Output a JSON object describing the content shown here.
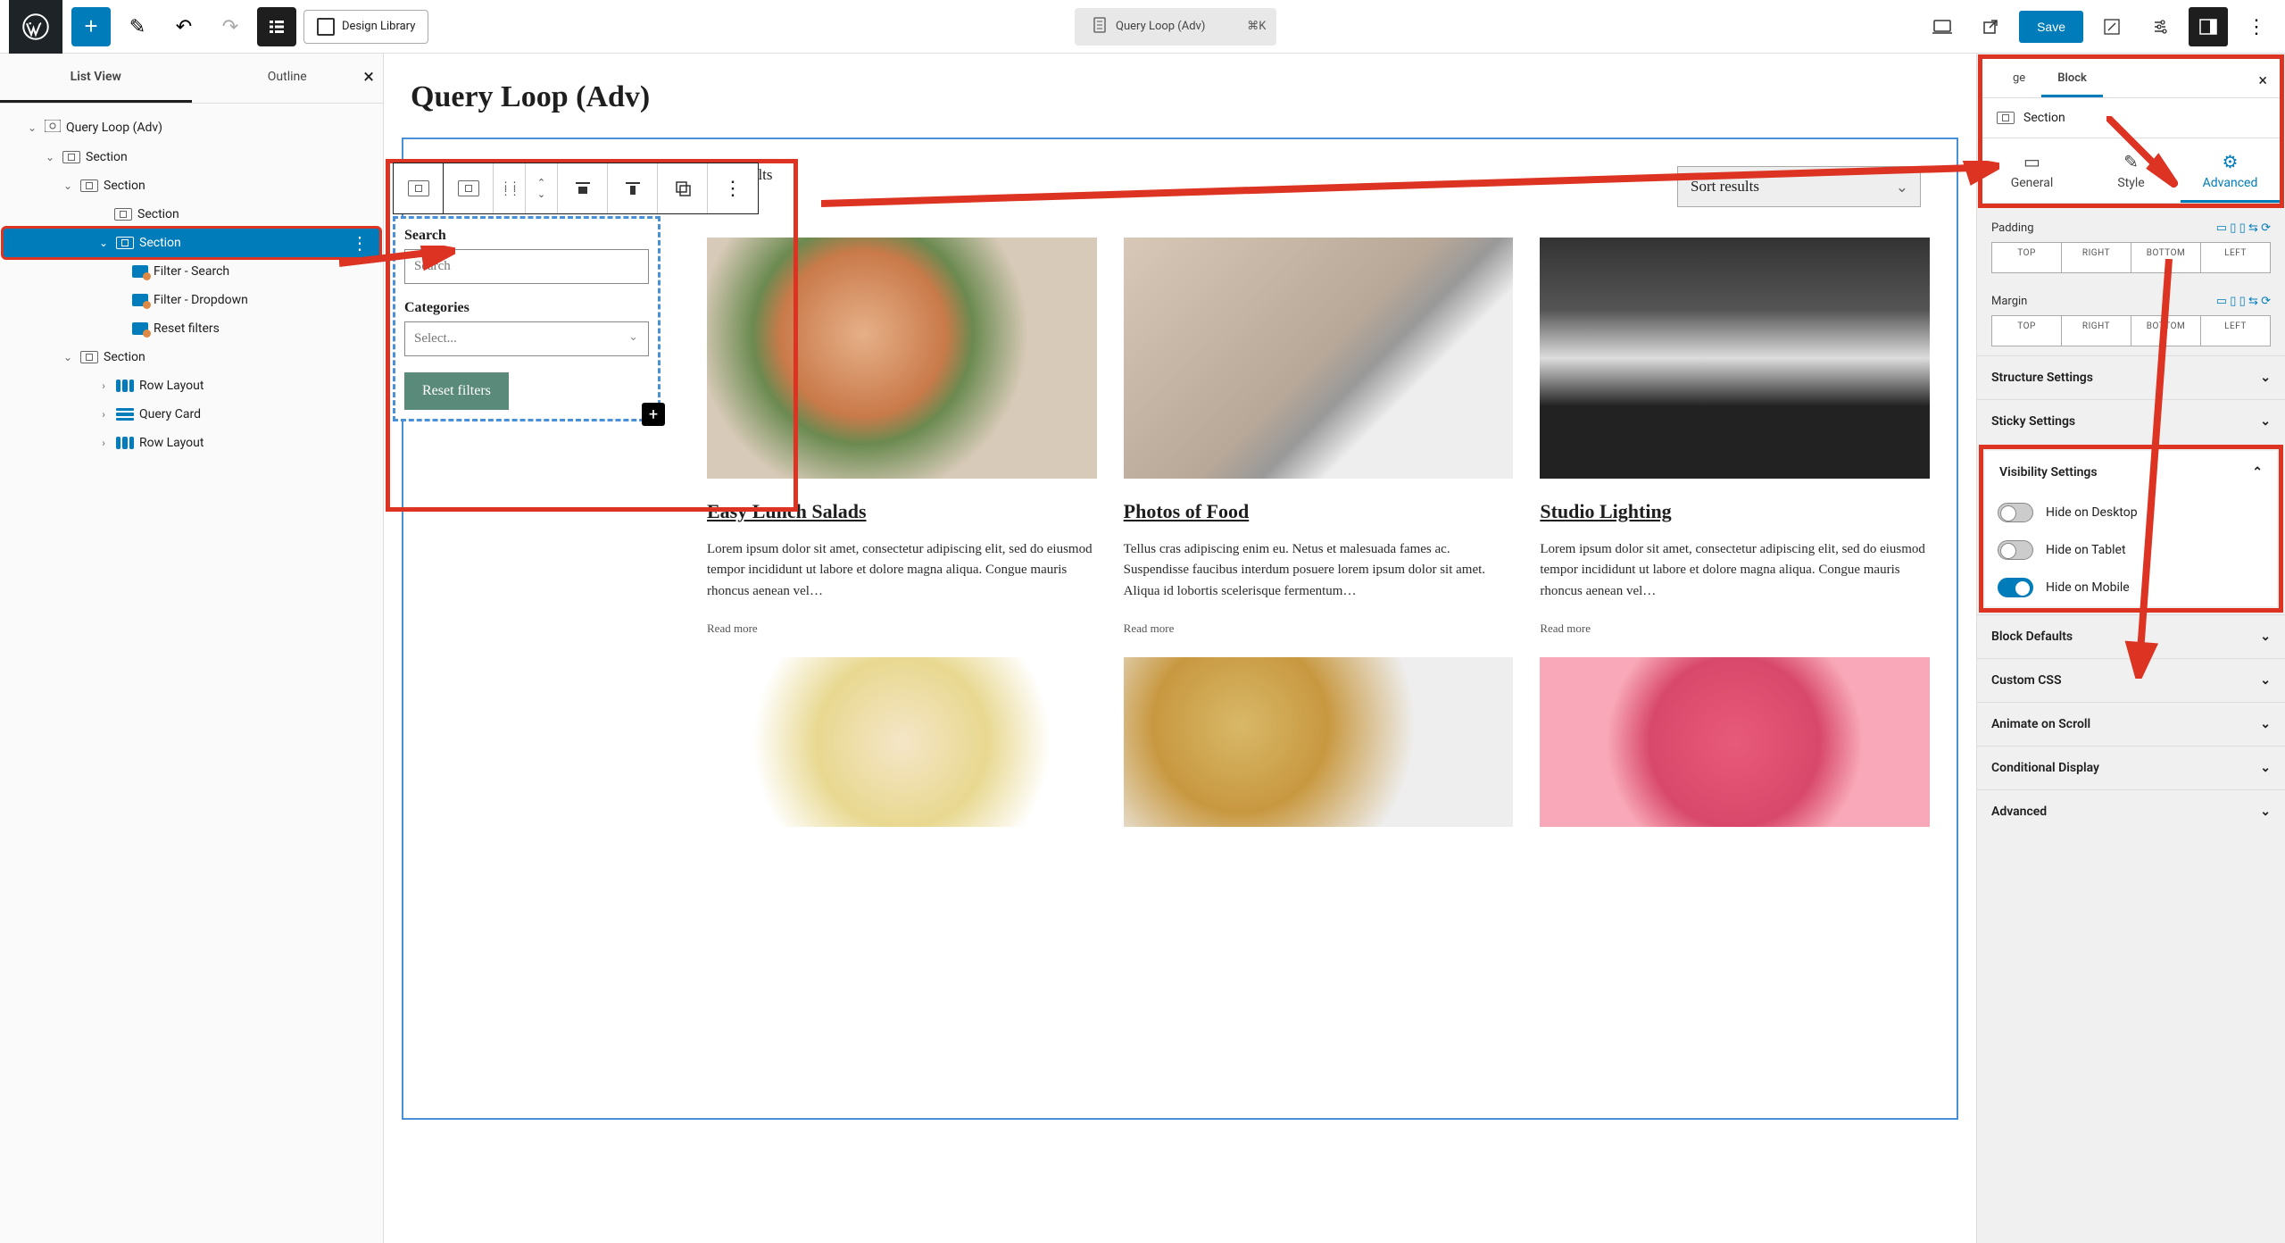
{
  "topbar": {
    "design_library": "Design Library",
    "page_title": "Query Loop (Adv)",
    "shortcut": "⌘K",
    "save": "Save"
  },
  "sidebar": {
    "tab_listview": "List View",
    "tab_outline": "Outline",
    "tree": {
      "root": "Query Loop (Adv)",
      "section": "Section",
      "filter_search": "Filter - Search",
      "filter_dropdown": "Filter - Dropdown",
      "reset_filters": "Reset filters",
      "row_layout": "Row Layout",
      "query_card": "Query Card"
    }
  },
  "canvas": {
    "title": "Query Loop (Adv)",
    "results_count": "10 results",
    "sort_label": "Sort results",
    "filter_panel": {
      "search_label": "Search",
      "search_placeholder": "Search",
      "categories_label": "Categories",
      "categories_placeholder": "Select...",
      "reset": "Reset filters"
    },
    "cards": [
      {
        "title": "Easy Lunch Salads",
        "body": "Lorem ipsum dolor sit amet, consectetur adipiscing elit, sed do eiusmod tempor incididunt ut labore et dolore magna aliqua. Congue mauris rhoncus aenean vel…",
        "read_more": "Read more"
      },
      {
        "title": "Photos of Food",
        "body": "Tellus cras adipiscing enim eu. Netus et malesuada fames ac. Suspendisse faucibus interdum posuere lorem ipsum dolor sit amet. Aliqua id lobortis scelerisque fermentum…",
        "read_more": "Read more"
      },
      {
        "title": "Studio Lighting",
        "body": "Lorem ipsum dolor sit amet, consectetur adipiscing elit, sed do eiusmod tempor incididunt ut labore et dolore magna aliqua. Congue mauris rhoncus aenean vel…",
        "read_more": "Read more"
      }
    ]
  },
  "rightbar": {
    "tab_page": "ge",
    "tab_block": "Block",
    "block_name": "Section",
    "sub_general": "General",
    "sub_style": "Style",
    "sub_advanced": "Advanced",
    "padding_label": "Padding",
    "margin_label": "Margin",
    "sides": {
      "top": "TOP",
      "right": "RIGHT",
      "bottom": "BOTTOM",
      "left": "LEFT"
    },
    "sections": {
      "structure": "Structure Settings",
      "sticky": "Sticky Settings",
      "visibility": "Visibility Settings",
      "block_defaults": "Block Defaults",
      "custom_css": "Custom CSS",
      "animate": "Animate on Scroll",
      "conditional": "Conditional Display",
      "advanced": "Advanced"
    },
    "visibility": {
      "desktop": "Hide on Desktop",
      "tablet": "Hide on Tablet",
      "mobile": "Hide on Mobile"
    }
  }
}
